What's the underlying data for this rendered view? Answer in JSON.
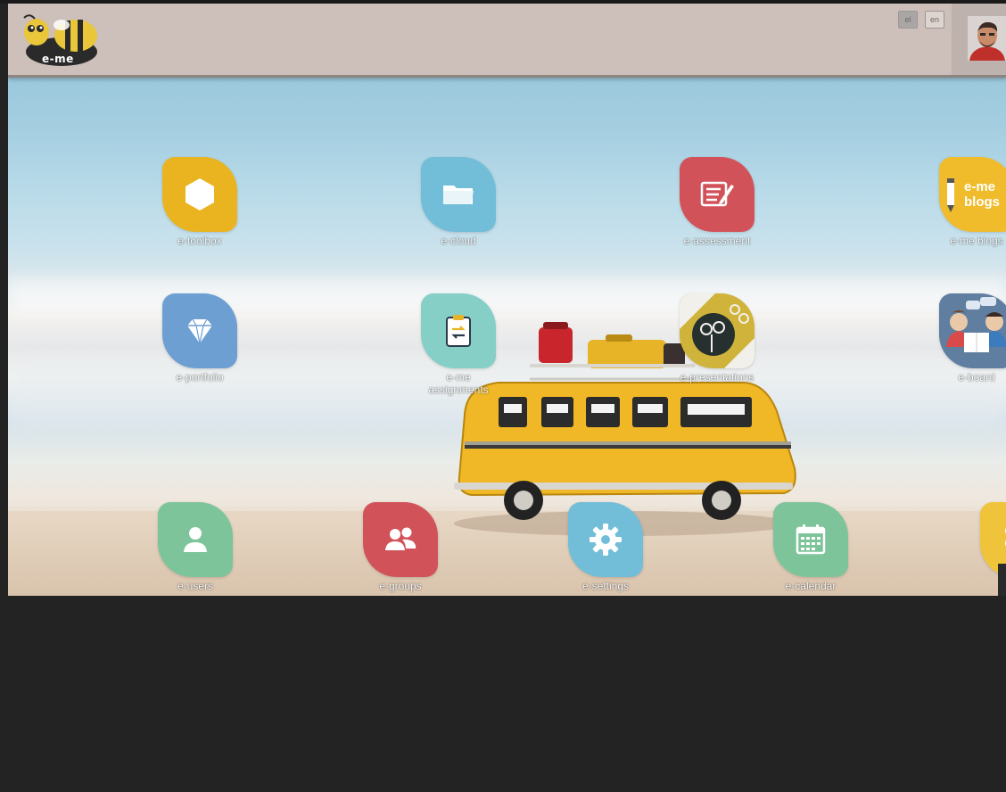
{
  "header": {
    "logo_text": "e-me",
    "lang_active": "el",
    "lang_other": "en"
  },
  "colors": {
    "header_bg": "#cdbfb9",
    "yellow": "#e9b420",
    "blue": "#72bed8",
    "red": "#d2525a",
    "steel_blue": "#6d9fd2",
    "teal": "#86cfc7",
    "olive": "#cfb33a",
    "green": "#7ec49a",
    "outer_bg": "#232323"
  },
  "desktop": {
    "row1": [
      {
        "label": "e-toolbox",
        "icon": "hexagon-icon",
        "color": "#e9b420"
      },
      {
        "label": "e-cloud",
        "icon": "folder-icon",
        "color": "#72bed8"
      },
      {
        "label": "e-assessment",
        "icon": "edit-list-icon",
        "color": "#d2525a"
      },
      {
        "label": "e-me blogs",
        "icon": "blogs-icon",
        "color": "#f0bc2c",
        "icon_text": "e-me\nblogs"
      }
    ],
    "row2": [
      {
        "label": "e-portfolio",
        "icon": "diamond-icon",
        "color": "#6d9fd2"
      },
      {
        "label": "e-me\nassignments",
        "icon": "clipboard-icon",
        "color": "#86cfc7"
      },
      {
        "label": "e-presentations",
        "icon": "dandelion-icon",
        "color": "#cfb33a"
      },
      {
        "label": "e-board",
        "icon": "forum-icon",
        "color": "#5f7ea0"
      }
    ],
    "row3": [
      {
        "label": "e-users",
        "icon": "user-icon",
        "color": "#7ec49a"
      },
      {
        "label": "e-groups",
        "icon": "users-icon",
        "color": "#d2525a"
      },
      {
        "label": "e-settings",
        "icon": "gear-icon",
        "color": "#72bed8"
      },
      {
        "label": "e-calendar",
        "icon": "calendar-icon",
        "color": "#7ec49a"
      },
      {
        "label": "",
        "icon": "partial-yellow-icon",
        "color": "#f0c43a"
      }
    ]
  }
}
